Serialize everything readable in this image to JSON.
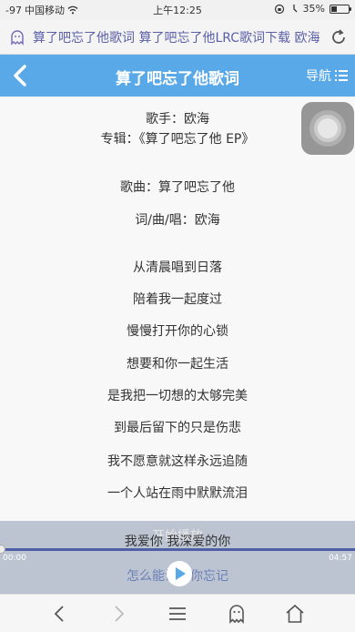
{
  "status_bar": {
    "signal": "-97",
    "carrier": "中国移动",
    "time": "上午12:25",
    "battery": "35%",
    "battery_level": 0.35
  },
  "browser": {
    "page_url": "算了吧忘了他歌词 算了吧忘了他LRC歌词下载 欧海"
  },
  "header": {
    "title": "算了吧忘了他歌词",
    "nav_label": "导航"
  },
  "song_info": {
    "singer": "歌手：欧海",
    "album": "专辑：《算了吧忘了他 EP》",
    "song": "歌曲：算了吧忘了他",
    "credits": "词/曲/唱：欧海"
  },
  "lyrics": [
    "从清晨唱到日落",
    "陪着我一起度过",
    "慢慢打开你的心锁",
    "想要和你一起生活",
    "是我把一切想的太够完美",
    "到最后留下的只是伤悲",
    "我不愿意就这样永远追随",
    "一个人站在雨中默默流泪"
  ],
  "player": {
    "start_label": "开始播放",
    "current_lyric": "我爱你 我深爱的你",
    "next_lyric": "怎么能说把你忘记",
    "current_time": "00:00",
    "total_time": "04:57",
    "progress": 0.0
  },
  "colors": {
    "header_blue": "#59a9e8",
    "url_text": "#5b5fa8"
  },
  "icons": {
    "back": "back-arrow-icon",
    "nav": "list-icon",
    "reload": "reload-icon",
    "ghost": "ghost-icon"
  }
}
